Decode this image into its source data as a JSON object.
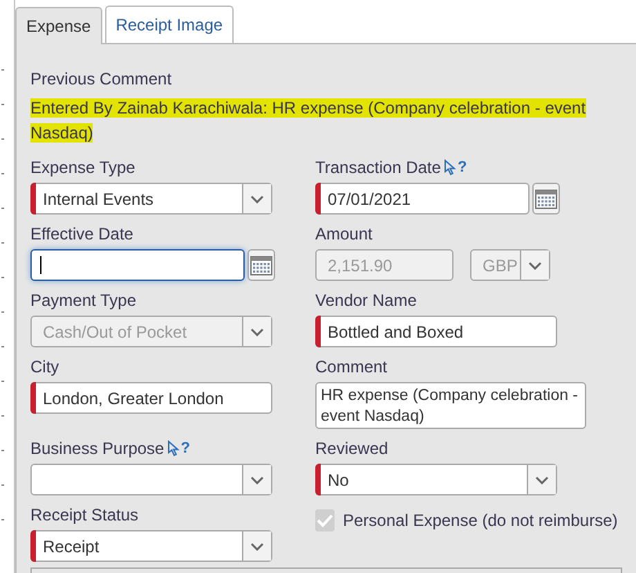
{
  "tabs": [
    {
      "label": "Expense",
      "selected": true
    },
    {
      "label": "Receipt Image",
      "selected": false
    }
  ],
  "previous_comment": {
    "label": "Previous Comment",
    "text": "Entered By Zainab Karachiwala: HR expense (Company celebration - event Nasdaq)"
  },
  "rows": [
    {
      "left": {
        "kind": "select",
        "label": "Expense Type",
        "value": "Internal Events",
        "required": true
      },
      "right": {
        "kind": "date",
        "label": "Transaction Date",
        "value": "07/01/2021",
        "required": true,
        "help": "?"
      }
    },
    {
      "left": {
        "kind": "date",
        "label": "Effective Date",
        "focused": true
      },
      "right": {
        "kind": "amount",
        "label": "Amount",
        "value": "2,151.90",
        "currency": "GBP",
        "disabled": true
      }
    },
    {
      "left": {
        "kind": "select",
        "label": "Payment Type",
        "value": "Cash/Out of Pocket",
        "disabled": true
      },
      "right": {
        "kind": "text",
        "label": "Vendor Name",
        "value": "Bottled and Boxed",
        "required": true
      }
    },
    {
      "left": {
        "kind": "text",
        "label": "City",
        "value": "London, Greater London",
        "required": true
      },
      "right": {
        "kind": "textarea",
        "label": "Comment",
        "value": "HR expense (Company celebration - event Nasdaq)"
      }
    },
    {
      "left": {
        "kind": "select",
        "label": "Business Purpose",
        "help": "?"
      },
      "right": {
        "kind": "select",
        "label": "Reviewed",
        "value": "No",
        "required": true
      }
    },
    {
      "left": {
        "kind": "select",
        "label": "Receipt Status",
        "value": "Receipt",
        "required": true
      },
      "right": {
        "kind": "checkbox",
        "label": "Personal Expense (do not reimburse)",
        "checked": true,
        "disabled": true
      }
    }
  ]
}
